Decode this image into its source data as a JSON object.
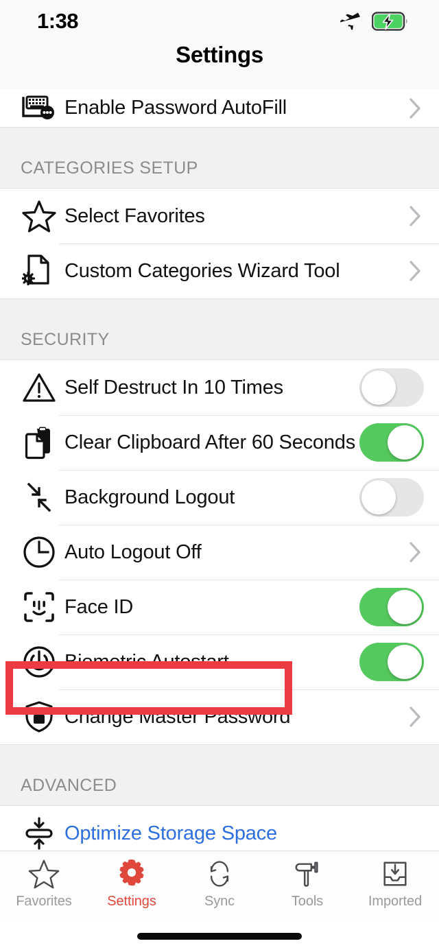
{
  "status_bar": {
    "time": "1:38",
    "airplane_icon": "airplane-mode-icon",
    "battery_icon": "battery-charging-icon",
    "battery_color": "#4CD263"
  },
  "nav": {
    "title": "Settings"
  },
  "partial_row": {
    "label": "Enable Password AutoFill",
    "icon": "keyboard-autofill-icon",
    "accessory": "chevron"
  },
  "sections": [
    {
      "header": "CATEGORIES SETUP",
      "rows": [
        {
          "label": "Select Favorites",
          "icon": "star-icon",
          "accessory": "chevron"
        },
        {
          "label": "Custom Categories Wizard Tool",
          "icon": "document-gear-icon",
          "accessory": "chevron"
        }
      ]
    },
    {
      "header": "SECURITY",
      "rows": [
        {
          "label": "Self Destruct In 10 Times",
          "icon": "warning-triangle-icon",
          "accessory": "toggle",
          "toggle_on": false
        },
        {
          "label": "Clear Clipboard After 60 Seconds",
          "icon": "clipboard-icon",
          "accessory": "toggle",
          "toggle_on": true
        },
        {
          "label": "Background Logout",
          "icon": "collapse-arrows-icon",
          "accessory": "toggle",
          "toggle_on": false
        },
        {
          "label": "Auto Logout Off",
          "icon": "clock-icon",
          "accessory": "chevron"
        },
        {
          "label": "Face ID",
          "icon": "face-id-icon",
          "accessory": "toggle",
          "toggle_on": true
        },
        {
          "label": "Biometric Autostart",
          "icon": "power-icon",
          "accessory": "toggle",
          "toggle_on": true
        },
        {
          "label": "Change Master Password",
          "icon": "shield-lock-icon",
          "accessory": "chevron",
          "highlighted": true
        }
      ]
    },
    {
      "header": "ADVANCED",
      "rows": [
        {
          "label": "Optimize Storage Space",
          "icon": "compress-icon",
          "accessory": "none",
          "link": true
        }
      ]
    }
  ],
  "highlight": {
    "target": "Change Master Password",
    "color": "#ED3B43"
  },
  "tab_bar": {
    "active": "Settings",
    "active_color": "#E0483C",
    "inactive_color": "#9A9A9E",
    "tabs": [
      {
        "label": "Favorites",
        "icon": "star-icon"
      },
      {
        "label": "Settings",
        "icon": "gear-icon"
      },
      {
        "label": "Sync",
        "icon": "sync-arrows-icon"
      },
      {
        "label": "Tools",
        "icon": "hammer-icon"
      },
      {
        "label": "Imported",
        "icon": "inbox-download-icon"
      }
    ]
  },
  "colors": {
    "toggle_on": "#54C95E",
    "toggle_off": "#E6E6E6",
    "link_blue": "#2D6FE0",
    "section_bg": "#F1F1F1",
    "section_text": "#8C8C90"
  }
}
